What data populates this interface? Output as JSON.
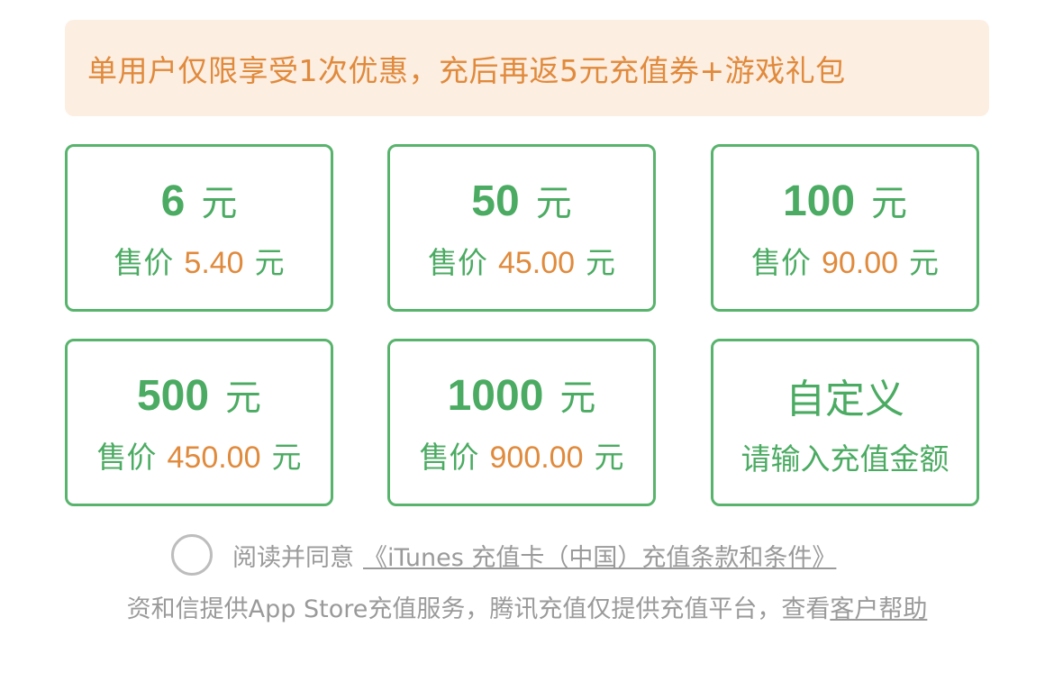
{
  "banner": {
    "text": "单用户仅限享受1次优惠，充后再返5元充值券+游戏礼包"
  },
  "cards": [
    {
      "amount": "6",
      "unit": "元",
      "price_label": "售价",
      "price": "5.40",
      "price_unit": "元"
    },
    {
      "amount": "50",
      "unit": "元",
      "price_label": "售价",
      "price": "45.00",
      "price_unit": "元"
    },
    {
      "amount": "100",
      "unit": "元",
      "price_label": "售价",
      "price": "90.00",
      "price_unit": "元"
    },
    {
      "amount": "500",
      "unit": "元",
      "price_label": "售价",
      "price": "450.00",
      "price_unit": "元"
    },
    {
      "amount": "1000",
      "unit": "元",
      "price_label": "售价",
      "price": "900.00",
      "price_unit": "元"
    }
  ],
  "custom": {
    "title": "自定义",
    "subtitle": "请输入充值金额"
  },
  "agreement": {
    "prefix": "阅读并同意",
    "link": "《iTunes 充值卡（中国）充值条款和条件》"
  },
  "footer": {
    "text": "资和信提供App Store充值服务，腾讯充值仅提供充值平台，查看",
    "link": "客户帮助"
  },
  "colors": {
    "green": "#4bab62",
    "border_green": "#58b36c",
    "orange": "#e08a3c",
    "banner_bg": "#fdeee2",
    "gray": "#9a9a9a"
  }
}
